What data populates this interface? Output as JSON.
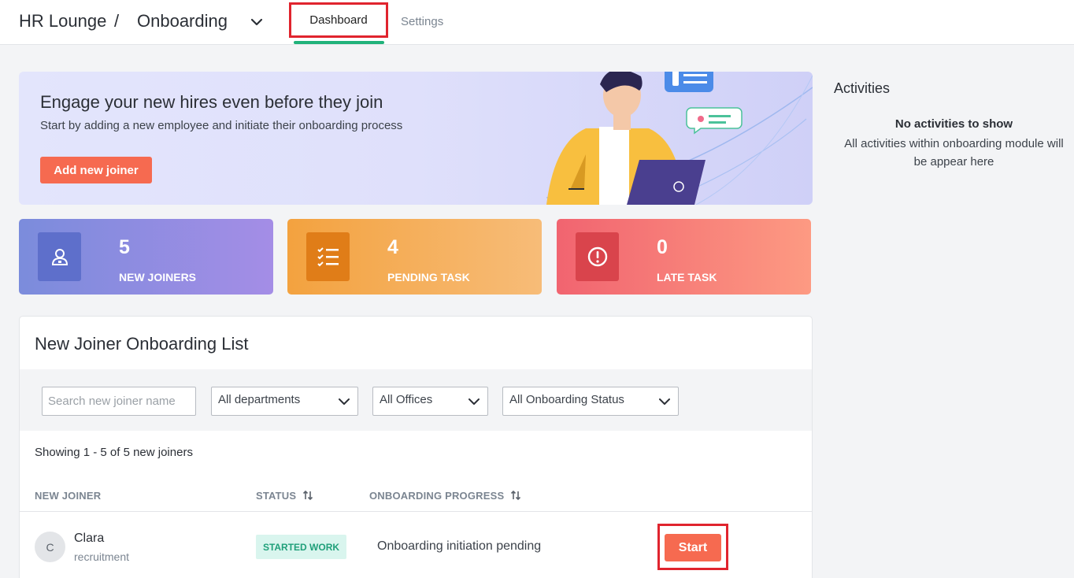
{
  "header": {
    "app_name": "HR Lounge",
    "separator": "/",
    "module": "Onboarding",
    "tabs": [
      {
        "label": "Dashboard",
        "active": true
      },
      {
        "label": "Settings",
        "active": false
      }
    ]
  },
  "hero": {
    "title": "Engage your new hires even before they join",
    "subtitle": "Start by adding a new employee and initiate their onboarding process",
    "button_label": "Add new joiner"
  },
  "stats": [
    {
      "value": "5",
      "label": "NEW JOINERS",
      "icon": "user-badge-icon"
    },
    {
      "value": "4",
      "label": "PENDING TASK",
      "icon": "checklist-icon"
    },
    {
      "value": "0",
      "label": "LATE TASK",
      "icon": "alert-circle-icon"
    }
  ],
  "list": {
    "title": "New Joiner Onboarding List",
    "search_placeholder": "Search new joiner name",
    "filters": {
      "department": "All departments",
      "office": "All Offices",
      "status": "All Onboarding Status"
    },
    "showing": "Showing 1 - 5 of 5 new joiners",
    "columns": [
      "NEW JOINER",
      "STATUS",
      "ONBOARDING PROGRESS"
    ],
    "rows": [
      {
        "initial": "C",
        "name": "Clara",
        "department": "recruitment",
        "status": "STARTED WORK",
        "progress": "Onboarding initiation pending",
        "action": "Start"
      }
    ]
  },
  "activities": {
    "title": "Activities",
    "empty_title": "No activities to show",
    "empty_desc": "All activities within onboarding module will be appear here"
  },
  "colors": {
    "accent_orange": "#f66a50",
    "tab_underline": "#20b27a",
    "highlight_red": "#e0242e"
  }
}
